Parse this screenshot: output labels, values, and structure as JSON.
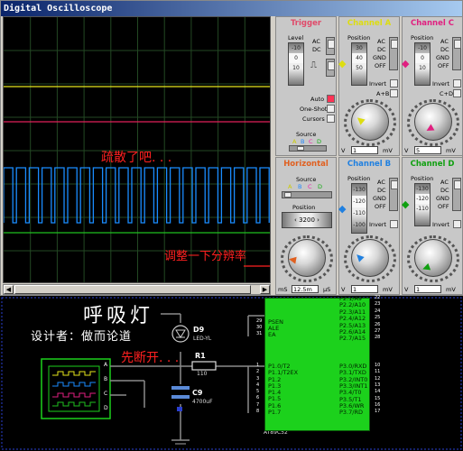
{
  "window": {
    "title": "Digital Oscilloscope"
  },
  "screen": {
    "overlay_text_1": "疏散了吧. . .",
    "overlay_text_2": "调整一下分辨率",
    "traces": {
      "yellow": "#e6e61c",
      "red": "#e0205a",
      "blue": "#1a8cff",
      "green": "#1fbf1f",
      "grid": "#234823"
    }
  },
  "trigger": {
    "title": "Trigger",
    "level_label": "Level",
    "ac": "AC",
    "dc": "DC",
    "drum": [
      "-10",
      "0",
      "10"
    ],
    "auto": "Auto",
    "one_shot": "One-Shot",
    "cursors": "Cursors",
    "source_label": "Source",
    "sources": [
      "A",
      "B",
      "C",
      "D"
    ]
  },
  "channel_a": {
    "title": "Channel A",
    "position_label": "Position",
    "drum": [
      "30",
      "40",
      "50"
    ],
    "ac": "AC",
    "dc": "DC",
    "gnd": "GND",
    "off": "OFF",
    "invert": "Invert",
    "apb": "A+B",
    "v_box": "1",
    "unit": "mV",
    "v_label": "V"
  },
  "channel_c": {
    "title": "Channel C",
    "position_label": "Position",
    "drum": [
      "-10",
      "0",
      "10"
    ],
    "ac": "AC",
    "dc": "DC",
    "gnd": "GND",
    "off": "OFF",
    "invert": "Invert",
    "cpd": "C+D",
    "v_box": "5",
    "unit": "mV",
    "v_label": "V"
  },
  "horizontal": {
    "title": "Horizontal",
    "source_label": "Source",
    "sources": [
      "A",
      "B",
      "C",
      "D"
    ],
    "position_label": "Position",
    "position_value": "3200",
    "ms": "mS",
    "time_box": "12.5m",
    "us": "μS"
  },
  "channel_b": {
    "title": "Channel B",
    "position_label": "Position",
    "drum": [
      "-130",
      "-120",
      "-110",
      "-100"
    ],
    "ac": "AC",
    "dc": "DC",
    "gnd": "GND",
    "off": "OFF",
    "invert": "Invert",
    "v_box": "1",
    "unit": "mV",
    "v_label": "V"
  },
  "channel_d": {
    "title": "Channel D",
    "position_label": "Position",
    "drum": [
      "-130",
      "-120",
      "-110"
    ],
    "ac": "AC",
    "dc": "DC",
    "gnd": "GND",
    "off": "OFF",
    "invert": "Invert",
    "v_box": "1",
    "unit": "mV",
    "v_label": "V"
  },
  "colors": {
    "trigger_title": "#e04a6a",
    "channel_a_title": "#dddd10",
    "channel_c_title": "#e02080",
    "horizontal_title": "#e06020",
    "channel_b_title": "#2080e0",
    "channel_d_title": "#10a010",
    "ui_gray": "#d4d0c8",
    "chip_green": "#1cd11c"
  },
  "circuit": {
    "title_glyphs": "呼吸灯",
    "designer": "设计者：做而论道",
    "note": "先断开. . .",
    "d9_ref": "D9",
    "d9_value": "LED-YL",
    "r1_ref": "R1",
    "r1_value": "110",
    "c9_ref": "C9",
    "c9_value": "4700uF",
    "scope_pins": [
      "A",
      "B",
      "C",
      "D"
    ],
    "chip_part": "AT89C52",
    "chip_left_pins": [
      "PSEN",
      "ALE",
      "EA",
      "P1.0/T2",
      "P1.1/T2EX",
      "P1.2",
      "P1.3",
      "P1.4",
      "P1.5",
      "P1.6",
      "P1.7"
    ],
    "chip_right_pins": [
      "P2.1/A9",
      "P2.2/A10",
      "P2.3/A11",
      "P2.4/A12",
      "P2.5/A13",
      "P2.6/A14",
      "P2.7/A15",
      "P3.0/RXD",
      "P3.1/TXD",
      "P3.2/INT0",
      "P3.3/INT1",
      "P3.4/T0",
      "P3.5/T1",
      "P3.6/WR",
      "P3.7/RD"
    ],
    "right_pin_numbers": [
      "22",
      "23",
      "24",
      "25",
      "26",
      "27",
      "28",
      "10",
      "11",
      "12",
      "13",
      "14",
      "15",
      "16",
      "17"
    ],
    "left_pin_numbers": [
      "29",
      "30",
      "31",
      "1",
      "2",
      "3",
      "4",
      "5",
      "6",
      "7",
      "8"
    ]
  }
}
